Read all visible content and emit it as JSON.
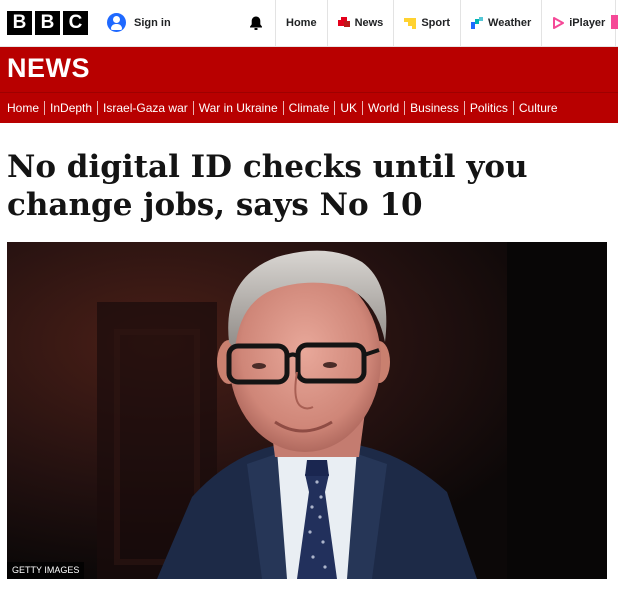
{
  "brand": {
    "logo_letters": [
      "B",
      "B",
      "C"
    ],
    "signin_label": "Sign in"
  },
  "topnav": {
    "items": [
      {
        "label": "Home",
        "icon": "home"
      },
      {
        "label": "News",
        "icon": "news-icon",
        "color": "#e4001b"
      },
      {
        "label": "Sport",
        "icon": "sport-icon",
        "color": "#ffd230"
      },
      {
        "label": "Weather",
        "icon": "weather-icon",
        "color": "#1f69ff"
      },
      {
        "label": "iPlayer",
        "icon": "iplayer-icon",
        "color": "#f54997"
      }
    ]
  },
  "section": {
    "title": "NEWS",
    "color": "#b80000",
    "subnav": [
      "Home",
      "InDepth",
      "Israel-Gaza war",
      "War in Ukraine",
      "Climate",
      "UK",
      "World",
      "Business",
      "Politics",
      "Culture"
    ]
  },
  "article": {
    "headline": "No digital ID checks until you change jobs, says No 10",
    "image_credit": "GETTY IMAGES"
  }
}
